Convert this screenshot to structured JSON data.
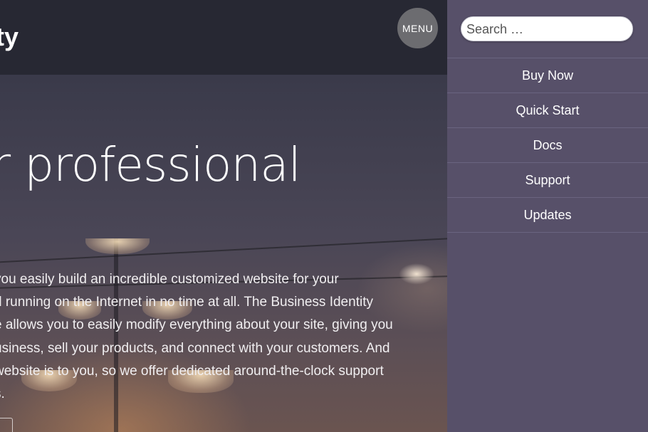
{
  "header": {
    "brand_fragment": "ty",
    "menu_label": "MENU"
  },
  "hero": {
    "title_fragment": "r professional",
    "body_lines": [
      "you easily build an incredible customized website for your",
      "d running on the Internet in no time at all. The Business Identity",
      "e allows you to easily modify everything about your site, giving you",
      "usiness, sell your products, and connect with your customers. And",
      "website is to you, so we offer dedicated around-the-clock support",
      "s."
    ]
  },
  "sidebar": {
    "search": {
      "placeholder": "Search …",
      "value": ""
    },
    "items": [
      {
        "label": "Buy Now"
      },
      {
        "label": "Quick Start"
      },
      {
        "label": "Docs"
      },
      {
        "label": "Support"
      },
      {
        "label": "Updates"
      }
    ]
  },
  "colors": {
    "sidebar_bg": "#575069",
    "topbar_bg": "#272833",
    "menu_button_bg": "#6c6c70"
  }
}
